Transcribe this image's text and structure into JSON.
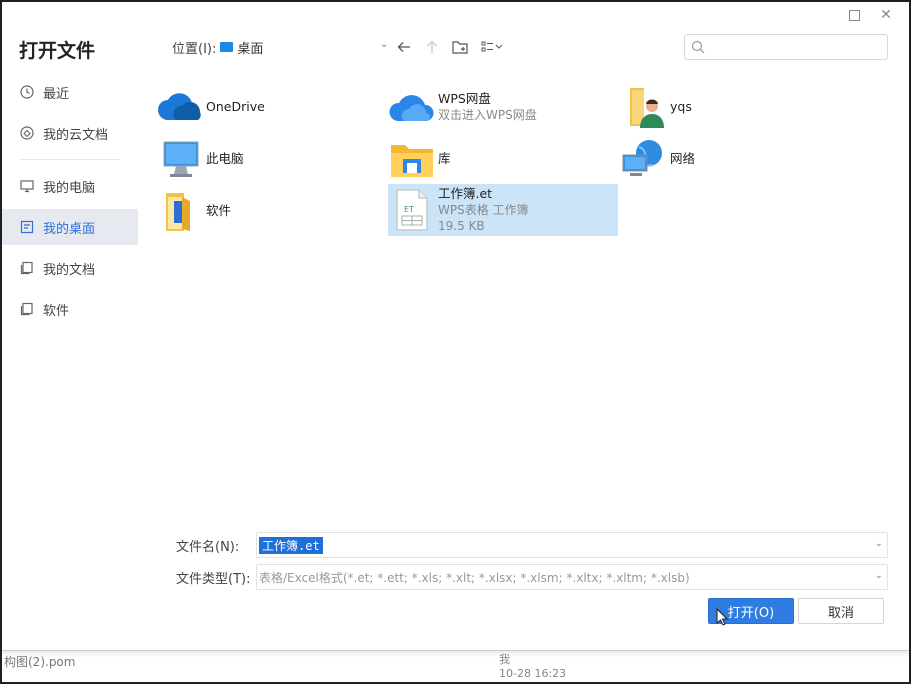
{
  "dialog": {
    "title": "打开文件"
  },
  "sidebar": {
    "items": [
      {
        "label": "最近",
        "icon": "clock-icon"
      },
      {
        "label": "我的云文档",
        "icon": "cloud-doc-icon"
      },
      {
        "label": "我的电脑",
        "icon": "monitor-icon"
      },
      {
        "label": "我的桌面",
        "icon": "desktop-icon",
        "active": true
      },
      {
        "label": "我的文档",
        "icon": "documents-icon"
      },
      {
        "label": "软件",
        "icon": "folder-outline-icon"
      }
    ]
  },
  "toolbar": {
    "location_label": "位置(I):",
    "location_value": "桌面",
    "search_placeholder": ""
  },
  "files": [
    {
      "name": "OneDrive",
      "sub": "",
      "icon": "onedrive-icon"
    },
    {
      "name": "WPS网盘",
      "sub": "双击进入WPS网盘",
      "icon": "wps-cloud-icon"
    },
    {
      "name": "yqs",
      "sub": "",
      "icon": "user-folder-icon"
    },
    {
      "name": "此电脑",
      "sub": "",
      "icon": "computer-icon"
    },
    {
      "name": "库",
      "sub": "",
      "icon": "library-folder-icon"
    },
    {
      "name": "网络",
      "sub": "",
      "icon": "network-icon"
    },
    {
      "name": "软件",
      "sub": "",
      "icon": "folder-icon"
    },
    {
      "name": "工作簿.et",
      "sub": "WPS表格 工作簿",
      "size": "19.5 KB",
      "icon": "et-file-icon",
      "selected": true
    }
  ],
  "form": {
    "filename_label": "文件名(N):",
    "filename_value": "工作簿.et",
    "filetype_label": "文件类型(T):",
    "filetype_value": "表格/Excel格式(*.et; *.ett; *.xls; *.xlt; *.xlsx; *.xlsm; *.xltx; *.xltm; *.xlsb)"
  },
  "buttons": {
    "open": "打开(O)",
    "cancel": "取消"
  },
  "underlay": {
    "left_text": "构图(2).pom",
    "right_line1": "我",
    "right_line2": "10-28 16:23"
  },
  "colors": {
    "accent": "#2f7de0",
    "sidebar_active_bg": "#e6e9ef",
    "selection_bg": "#cce4f7"
  }
}
